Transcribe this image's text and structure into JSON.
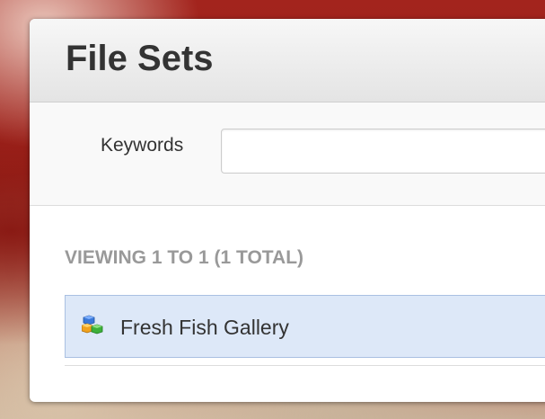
{
  "page": {
    "title": "File Sets"
  },
  "search": {
    "label": "Keywords",
    "value": "",
    "placeholder": ""
  },
  "results": {
    "summary": "VIEWING 1 TO 1 (1 TOTAL)",
    "items": [
      {
        "label": "Fresh Fish Gallery",
        "icon": "file-set-icon",
        "selected": true
      }
    ]
  },
  "colors": {
    "row_selected_bg": "#dde8f8",
    "row_selected_border": "#a9c0e2",
    "summary_text": "#999999"
  }
}
